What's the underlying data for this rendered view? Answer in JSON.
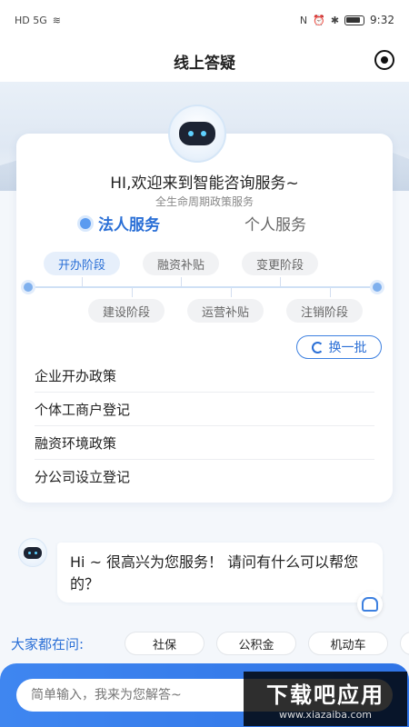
{
  "status_bar": {
    "time": "9:32",
    "left_icons": "HD 5G",
    "colors": {
      "text": "#333333"
    }
  },
  "header": {
    "title": "线上答疑",
    "record_icon": "record-icon"
  },
  "welcome": {
    "title": "HI,欢迎来到智能咨询服务~",
    "subtitle": "全生命周期政策服务"
  },
  "service_tabs": {
    "legal": "法人服务",
    "personal": "个人服务",
    "active": "legal"
  },
  "stages_top": [
    "开办阶段",
    "融资补贴",
    "变更阶段"
  ],
  "stages_bottom": [
    "建设阶段",
    "运营补贴",
    "注销阶段"
  ],
  "active_stage": "开办阶段",
  "refresh_label": "换一批",
  "policies": [
    "企业开办政策",
    "个体工商户登记",
    "融资环境政策",
    "分公司设立登记"
  ],
  "chat": {
    "message": "Hi ~ 很高兴为您服务！ 请问有什么可以帮您的？"
  },
  "hot": {
    "label": "大家都在问:",
    "items": [
      "社保",
      "公积金",
      "机动车"
    ]
  },
  "input": {
    "placeholder": "简单输入，我来为您解答~"
  },
  "watermark": {
    "main": "下载吧应用",
    "url": "www.xiazaiba.com"
  },
  "colors": {
    "accent": "#2a6fd6",
    "bar": "#3f86f0"
  }
}
